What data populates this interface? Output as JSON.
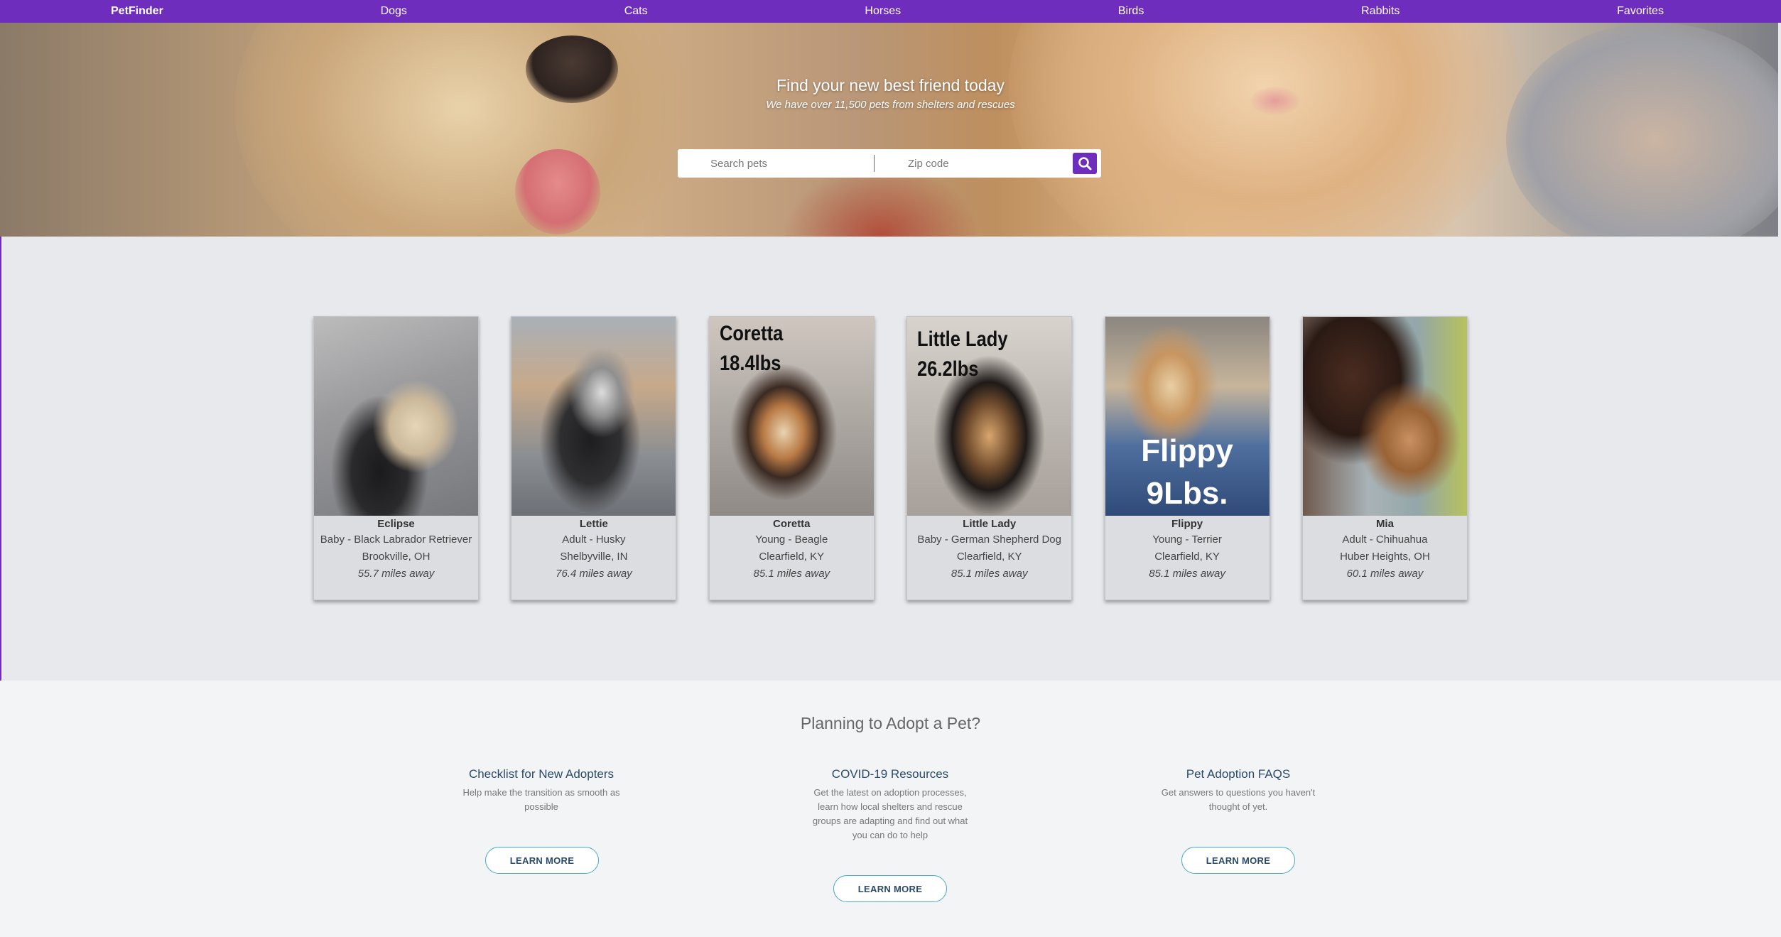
{
  "nav": {
    "brand": "PetFinder",
    "items": [
      "Dogs",
      "Cats",
      "Horses",
      "Birds",
      "Rabbits",
      "Favorites"
    ]
  },
  "hero": {
    "title": "Find your new best friend today",
    "subtitle": "We have over 11,500 pets from shelters and rescues",
    "search_placeholder": "Search pets",
    "zip_placeholder": "Zip code"
  },
  "pets": [
    {
      "name": "Eclipse",
      "desc": "Baby - Black Labrador Retriever",
      "location": "Brookville, OH",
      "distance": "55.7 miles away",
      "overlay": []
    },
    {
      "name": "Lettie",
      "desc": "Adult - Husky",
      "location": "Shelbyville, IN",
      "distance": "76.4 miles away",
      "overlay": []
    },
    {
      "name": "Coretta",
      "desc": "Young - Beagle",
      "location": "Clearfield, KY",
      "distance": "85.1 miles away",
      "overlay": [
        "Coretta",
        "18.4lbs"
      ]
    },
    {
      "name": "Little Lady",
      "desc": "Baby - German Shepherd Dog",
      "location": "Clearfield, KY",
      "distance": "85.1 miles away",
      "overlay": [
        "Little Lady",
        "26.2lbs"
      ]
    },
    {
      "name": "Flippy",
      "desc": "Young - Terrier",
      "location": "Clearfield, KY",
      "distance": "85.1 miles away",
      "overlay": [
        "Flippy",
        "9Lbs."
      ]
    },
    {
      "name": "Mia",
      "desc": "Adult - Chihuahua",
      "location": "Huber Heights, OH",
      "distance": "60.1 miles away",
      "overlay": []
    }
  ],
  "adopt": {
    "heading": "Planning to Adopt a Pet?",
    "columns": [
      {
        "title": "Checklist for New Adopters",
        "text": "Help make the transition as smooth as possible",
        "button": "LEARN MORE"
      },
      {
        "title": "COVID-19 Resources",
        "text": "Get the latest on adoption processes, learn how local shelters and rescue groups are adapting and find out what you can do to help",
        "button": "LEARN MORE"
      },
      {
        "title": "Pet Adoption FAQS",
        "text": "Get answers to questions you haven't thought of yet.",
        "button": "LEARN MORE"
      }
    ]
  },
  "colors": {
    "brand": "#6f2dbd",
    "button_border": "#4aa8c4",
    "link": "#2a4a6b"
  },
  "icons": {
    "search": "search-icon"
  }
}
